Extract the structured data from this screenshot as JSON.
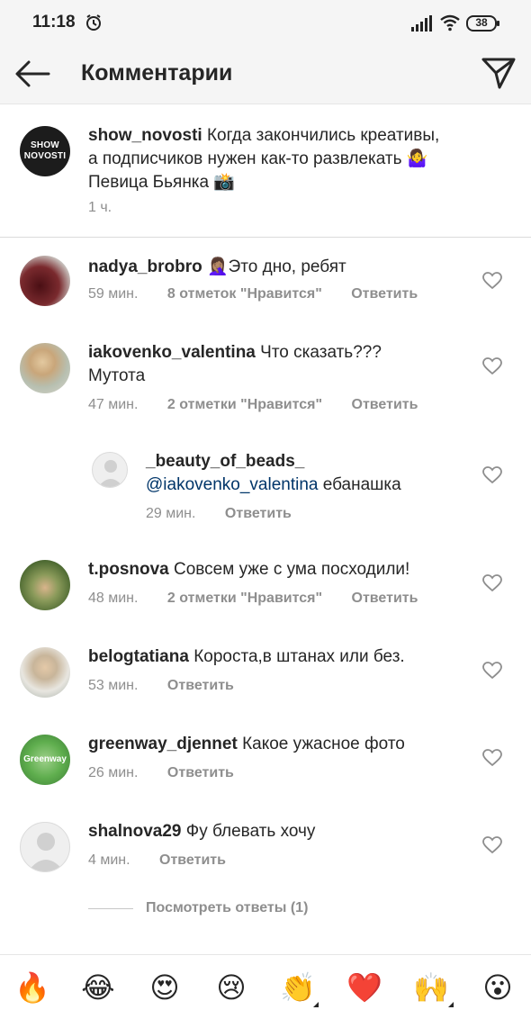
{
  "status": {
    "time": "11:18",
    "battery": "38"
  },
  "header": {
    "title": "Комментарии"
  },
  "caption": {
    "logo_line1": "SHOW",
    "logo_line2": "NOVOSTI",
    "username": "show_novosti",
    "text1": "Когда закончились креативы,",
    "text2": "а подписчиков нужен как-то развлекать 🤷‍♀️",
    "text3": "Певица Бьянка 📸",
    "time": "1 ч."
  },
  "comments": [
    {
      "username": "nadya_brobro",
      "text": "🤦🏽‍♀️Это дно, ребят",
      "time": "59 мин.",
      "likes": "8 отметок \"Нравится\"",
      "reply": "Ответить",
      "avatar_color": "#6b2a2a"
    },
    {
      "username": "iakovenko_valentina",
      "text": "Что сказать???",
      "text2": "Мутота",
      "time": "47 мин.",
      "likes": "2 отметки \"Нравится\"",
      "reply": "Ответить",
      "avatar_color": "#c9b79a"
    },
    {
      "username": "_beauty_of_beads_",
      "mention": "@iakovenko_valentina",
      "text": "ебанашка",
      "time": "29 мин.",
      "reply": "Ответить"
    },
    {
      "username": "t.posnova",
      "text": "Совсем уже с ума посходили!",
      "time": "48 мин.",
      "likes": "2 отметки \"Нравится\"",
      "reply": "Ответить",
      "avatar_color": "#5f7a3e"
    },
    {
      "username": "belogtatiana",
      "text": "Короста,в штанах или без.",
      "time": "53 мин.",
      "reply": "Ответить",
      "avatar_color": "#9aa6a0"
    },
    {
      "username": "greenway_djennet",
      "text": "Какое ужасное фото",
      "time": "26 мин.",
      "reply": "Ответить",
      "avatar_label": "Greenway"
    },
    {
      "username": "shalnova29",
      "text": "Фу блевать хочу",
      "time": "4 мин.",
      "reply": "Ответить"
    }
  ],
  "view_replies": "Посмотреть ответы (1)",
  "emojis": [
    "🔥",
    "😂",
    "😍",
    "😢",
    "👏",
    "❤️",
    "🙌",
    "😮"
  ],
  "colors": {
    "text": "#262626",
    "secondary": "#8e8e8e",
    "mention": "#003569",
    "bar_bg": "#f5f5f5"
  }
}
